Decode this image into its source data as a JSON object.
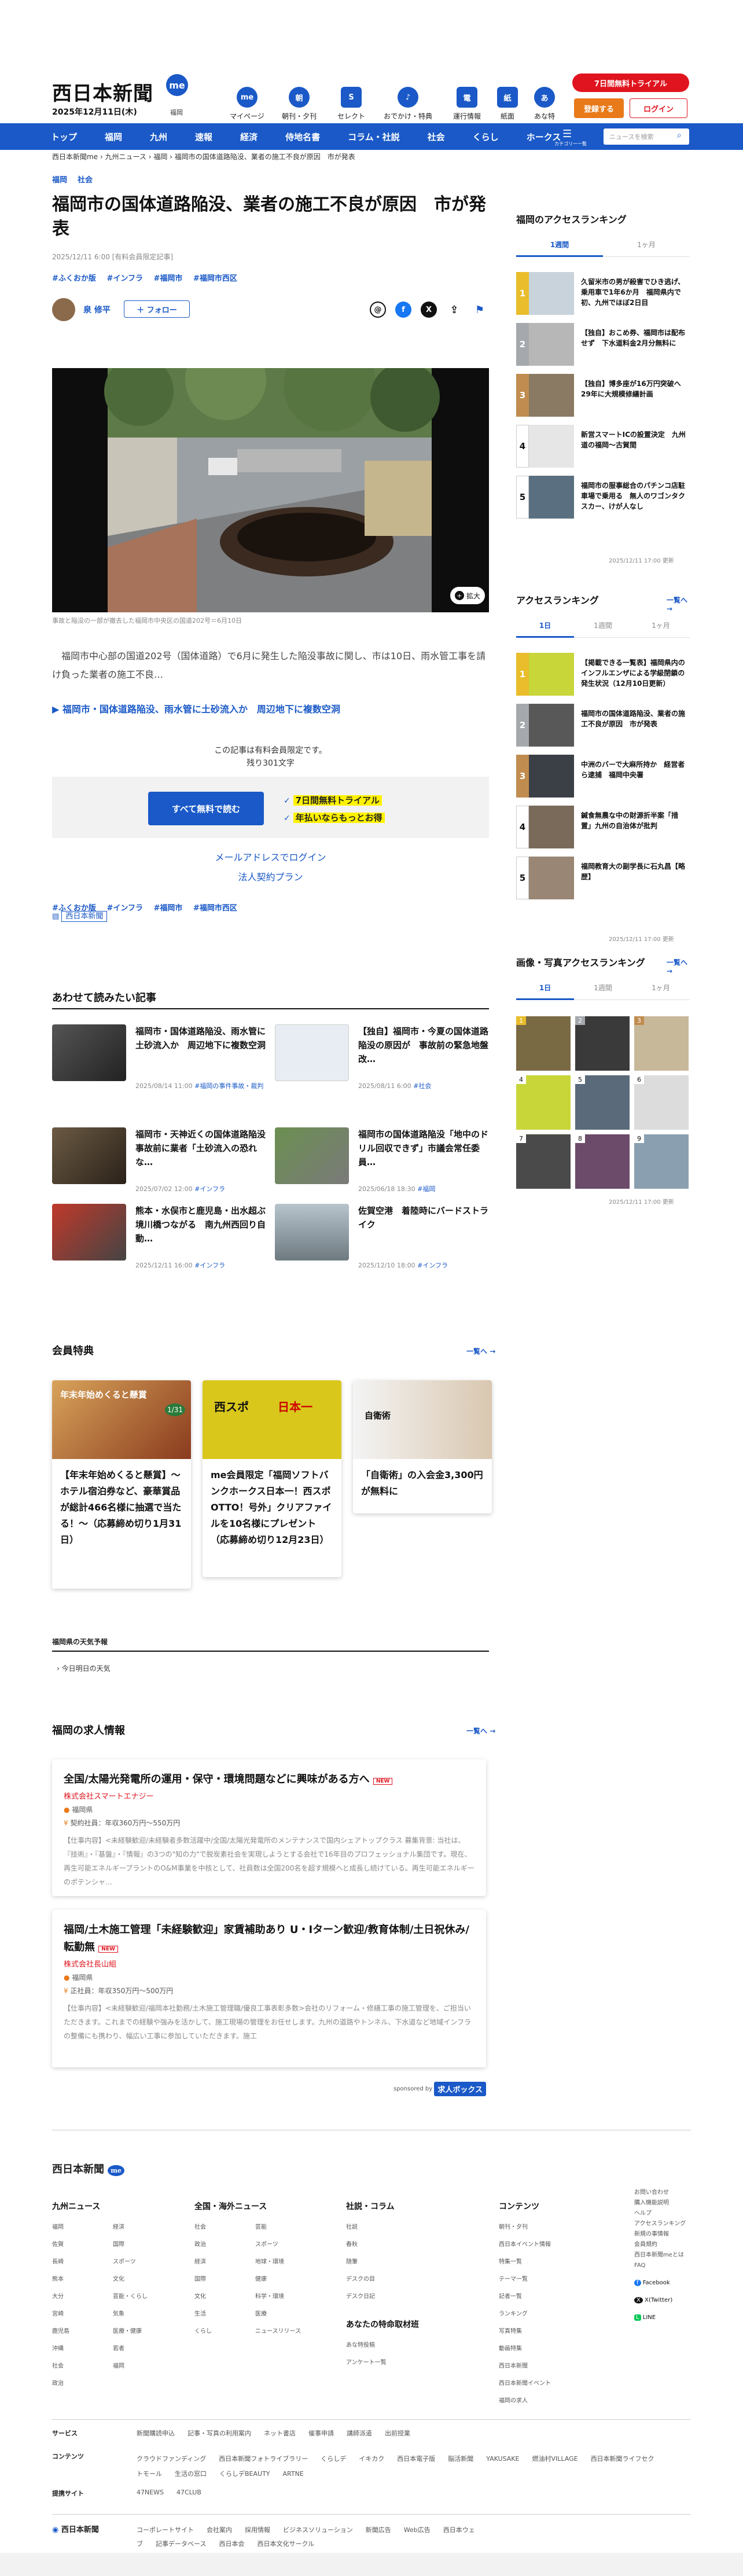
{
  "header": {
    "logo": "西日本新聞",
    "logo_badge": "me",
    "date": "2025年12月11日(木)",
    "area": "福岡",
    "icons": [
      {
        "label": "マイページ",
        "icon": "me-icon",
        "glyph": "me"
      },
      {
        "label": "朝刊・夕刊",
        "icon": "newspaper-icon",
        "glyph": "朝"
      },
      {
        "label": "セレクト",
        "icon": "select-icon",
        "glyph": "S"
      },
      {
        "label": "おでかけ・特典",
        "icon": "footprint-icon",
        "glyph": "♪"
      },
      {
        "label": "運行情報",
        "icon": "train-icon",
        "glyph": "電"
      },
      {
        "label": "紙面",
        "icon": "paper-icon",
        "glyph": "紙"
      },
      {
        "label": "あな特",
        "icon": "person-icon",
        "glyph": "あ"
      }
    ],
    "trial_label": "7日間無料トライアル",
    "register_label": "登録する",
    "login_label": "ログイン"
  },
  "nav": {
    "items": [
      "トップ",
      "福岡",
      "九州",
      "速報",
      "経済",
      "侍地名書",
      "コラム・社説",
      "社会",
      "くらし",
      "ホークス"
    ],
    "search_placeholder": "ニュースを検索",
    "menu_label": "カテゴリー一覧"
  },
  "breadcrumb": "西日本新聞me  ›  九州ニュース  ›  福岡  ›  福岡市の国体道路陥没、業者の施工不良が原因　市が発表",
  "article": {
    "categories": [
      "福岡",
      "社会"
    ],
    "title": "福岡市の国体道路陥没、業者の施工不良が原因　市が発表",
    "date": "2025/12/11 6:00 [有料会員限定記事]",
    "tags": [
      "#ふくおか版",
      "#インフラ",
      "#福岡市",
      "#福岡市西区"
    ],
    "author": "泉 修平",
    "follow_label": "＋ フォロー",
    "photo_caption": "事故と陥没の一部が撤去した福岡市中央区の国道202号＝6月10日",
    "zoom_label": "拡大",
    "lead": "福岡市中心部の国道202号（国体道路）で6月に発生した陥没事故に関し、市は10日、雨水管工事を請け負った業者の施工不良…",
    "related_link": "福岡市・国体道路陥没、雨水管に土砂流入か　周辺地下に複数空洞",
    "paywall_note": "この記事は有料会員限定です。",
    "paywall_remaining": "残り301文字",
    "pay_button": "すべて無料で読む",
    "pay_point1": "7日間無料トライアル",
    "pay_point2": "年払いならもっとお得",
    "email_login": "メールアドレスでログイン",
    "corporate": "法人契約プラン",
    "bottom_tags": [
      "#ふくおか版",
      "#インフラ",
      "#福岡市",
      "#福岡市西区"
    ],
    "publisher_badge": "西日本新聞"
  },
  "recommended": {
    "title": "あわせて読みたい記事",
    "items": [
      {
        "title": "福岡市・国体道路陥没、雨水管に土砂流入か　周辺地下に複数空洞",
        "date": "2025/08/14 11:00",
        "tag": "#福岡の事件事故・裁判"
      },
      {
        "title": "【独自】福岡市・今夏の国体道路陥没の原因が　事故前の緊急地盤改…",
        "date": "2025/08/11 6:00",
        "tag": "#社会"
      },
      {
        "title": "福岡市・天神近くの国体道路陥没　事故前に業者「土砂流入の恐れな…",
        "date": "2025/07/02 12:00",
        "tag": "#インフラ"
      },
      {
        "title": "福岡市の国体道路陥没「地中のドリル回収できず」市議会常任委員…",
        "date": "2025/06/18 18:30",
        "tag": "#福岡"
      },
      {
        "title": "熊本・水俣市と鹿児島・出水超ぶ境川橋つながる　南九州西回り自動…",
        "date": "2025/12/11 16:00",
        "tag": "#インフラ"
      },
      {
        "title": "佐賀空港　着陸時にバードストライク",
        "date": "2025/12/10 18:00",
        "tag": "#インフラ"
      }
    ]
  },
  "benefits": {
    "title": "会員特典",
    "more": "一覧へ",
    "items": [
      "【年末年始めくると懸賞】～ホテル宿泊券など、豪華賞品が総計466名様に抽選で当たる！～（応募締め切り1月31日）",
      "me会員限定「福岡ソフトバンクホークス日本一！西スポOTTO！号外」クリアファイルを10名様にプレゼント（応募締め切り12月23日）",
      "「自衛術」の入会金3,300円が無料に"
    ],
    "img_labels": [
      "年末年始めくると懸賞",
      "1/31",
      "西スポ",
      "日本一",
      "自衛術"
    ]
  },
  "weather": {
    "title": "福岡県の天気予報",
    "item": "今日明日の天気"
  },
  "jobs": {
    "title": "福岡の求人情報",
    "more": "一覧へ",
    "items": [
      {
        "title": "全国/太陽光発電所の運用・保守・環境問題などに興味がある方へ",
        "new": "NEW",
        "company": "株式会社スマートエナジー",
        "area": "福岡県",
        "salary": "契約社員：年収360万円〜550万円",
        "body": "【仕事内容】<未経験歓迎/未経験者多数活躍中/全国/太陽光発電所のメンテナンスで国内シェアトップクラス 募集背景: 当社は、『技術』・『基盤』・『情報』の3つの\"知の力\"で脱炭素社会を実現しようとする会社で16年目のプロフェッショナル集団です。現在、再生可能エネルギープラントのO&M事業を中核として、社員数は全国200名を超す規模へと成長し続けている。再生可能エネルギーのポテンシャ…"
      },
      {
        "title": "福岡/土木施工管理「未経験歓迎」家賃補助あり U・Iターン歓迎/教育体制/土日祝休み/転勤無",
        "new": "NEW",
        "company": "株式会社長山組",
        "area": "福岡県",
        "salary": "正社員：年収350万円〜500万円",
        "body": "【仕事内容】<未経験歓迎/福岡本社勤務/土木施工管理職/優良工事表彰多数>会社のリフォーム・修繕工事の施工管理を、ご担当いただきます。これまでの経験や強みを活かして、施工現場の管理をお任せします。九州の道路やトンネル、下水道など地域インフラの整備にも携わり、幅広い工事に参加していただきます。施工"
      }
    ],
    "sponsored": "sponsored by",
    "sponsor_logo": "求人ボックス"
  },
  "sidebar": {
    "fukuoka_rank": {
      "title": "福岡のアクセスランキング",
      "tabs": [
        "1週間",
        "1ヶ月"
      ],
      "items": [
        "久留米市の男が殺害でひき逃げ、乗用車で1年6か月　福岡県内で初、九州でほぼ2日目",
        "【独自】おこめ券、福岡市は配布せず　下水道料金2月分無料に",
        "【独自】博多座が16万円突破へ　29年に大規模修繕計画",
        "新営スマートICの設置決定　九州道の福岡〜古賀間",
        "福岡市の服事総合のパチンコ店駐車場で乗用る　無人のワゴンタクスカー、けが人なし"
      ],
      "time": "2025/12/11 17:00 更新"
    },
    "access_rank": {
      "title": "アクセスランキング",
      "more": "一覧へ",
      "tabs": [
        "1日",
        "1週間",
        "1ヶ月"
      ],
      "items": [
        "【掲載できる一覧表】福岡県内のインフルエンザによる学級閉鎖の発生状況（12月10日更新）",
        "福岡市の国体道路陥没、業者の施工不良が原因　市が発表",
        "中洲のバーで大麻所持か　経営者ら逮捕　福岡中央署",
        "鍼食無農な中の財源折半案「措置」九州の自治体が批判",
        "福岡教育大の副学長に石丸昌【略歴】"
      ],
      "time": "2025/12/11 17:00 更新"
    },
    "photo_rank": {
      "title": "画像・写真アクセスランキング",
      "more": "一覧へ",
      "tabs": [
        "1日",
        "1週間",
        "1ヶ月"
      ],
      "time": "2025/12/11 17:00 更新"
    }
  },
  "footer": {
    "logo": "西日本新聞",
    "logo_badge": "me",
    "cols": [
      {
        "title": "九州ニュース",
        "items": [
          "福岡",
          "佐賀",
          "長崎",
          "熊本",
          "大分",
          "宮崎",
          "鹿児島",
          "沖縄",
          "社会",
          "政治",
          "経済",
          "国際",
          "スポーツ",
          "文化",
          "芸能・くらし",
          "気象",
          "医療・健康",
          "若者",
          "福岡"
        ]
      },
      {
        "title": "全国・海外ニュース",
        "items": [
          "社会",
          "政治",
          "経済",
          "国際",
          "文化",
          "生活",
          "くらし",
          "芸能",
          "スポーツ",
          "地球・環境",
          "健康",
          "科学・環境",
          "医療",
          "ニュースリリース"
        ]
      },
      {
        "title": "社説・コラム",
        "items": [
          "社説",
          "春秋",
          "随筆",
          "デスクの目",
          "デスク日記"
        ]
      },
      {
        "title": "コンテンツ",
        "items": [
          "朝刊・夕刊",
          "西日本イベント情報",
          "特集一覧",
          "テーマ一覧",
          "記者一覧",
          "ランキング",
          "写真特集",
          "動画特集",
          "西日本新聞",
          "西日本新聞イベント",
          "福岡の求人"
        ]
      }
    ],
    "special": {
      "title": "あなたの特命取材班",
      "items": [
        "あな特投稿",
        "アンケート一覧"
      ]
    },
    "right_links": [
      "お問い合わせ",
      "購入機能説明",
      "ヘルプ",
      "アクセスランキング",
      "新規の事情報",
      "会員規約",
      "西日本新聞meとは",
      "FAQ"
    ],
    "socials": [
      "Facebook",
      "X(Twitter)",
      "LINE"
    ],
    "service_label": "サービス",
    "service_items": [
      "新聞購読申込",
      "記事・写真の利用案内",
      "ネット書店",
      "催事申請",
      "講師派遣",
      "出前授業"
    ],
    "content_label": "コンテンツ",
    "content_items": [
      "クラウドファンディング",
      "西日本新聞フォトライブラリー",
      "くらしデ",
      "イキカク",
      "西日本電子版",
      "脳活新聞",
      "YAKUSAKE",
      "燃油村VILLAGE",
      "西日本新聞ライフセクトモール",
      "生活の窓口",
      "くらしデBEAUTY",
      "ARTNE"
    ],
    "partner_label": "提携サイト",
    "partner_items": [
      "47NEWS",
      "47CLUB"
    ],
    "bottom_links": [
      "コーポレートサイト",
      "会社案内",
      "採用情報",
      "ビジネスソリューション",
      "新聞広告",
      "Web広告",
      "西日本ウェブ",
      "記事データベース",
      "西日本会",
      "西日本文化サークル"
    ],
    "company_logo": "西日本新聞"
  }
}
